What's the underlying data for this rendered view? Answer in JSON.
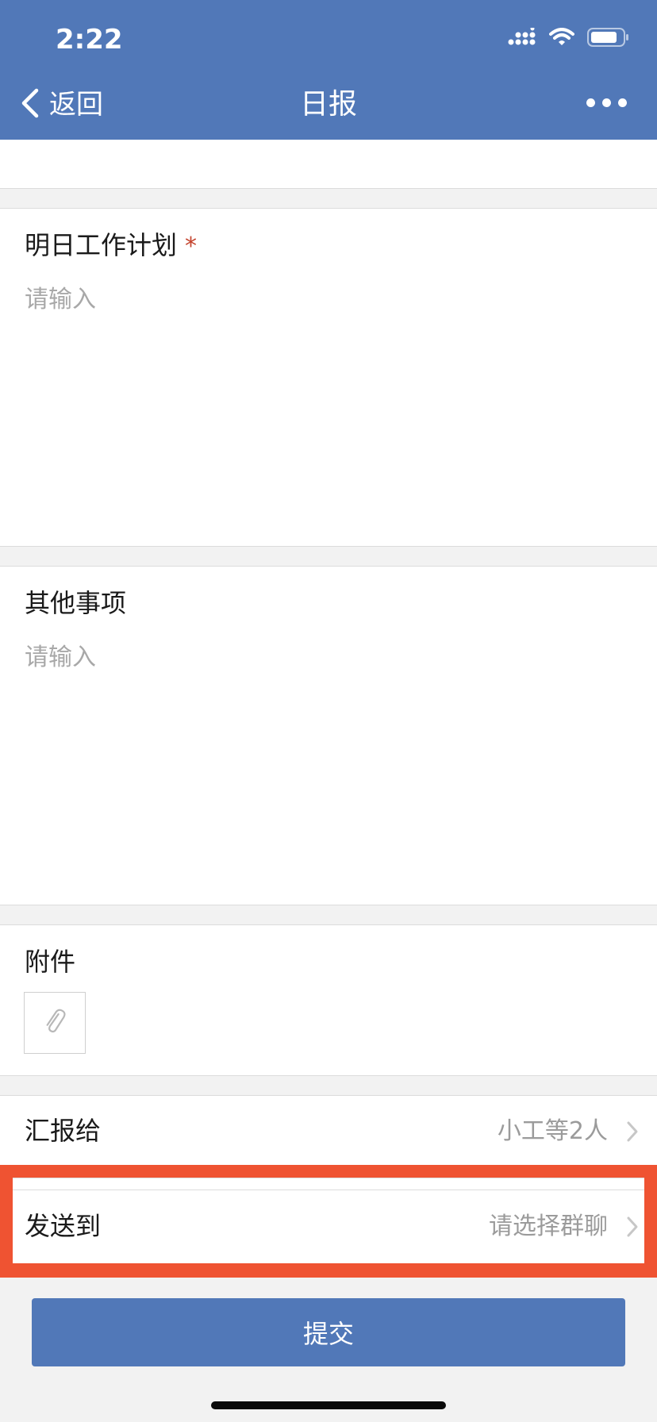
{
  "status": {
    "time": "2:22"
  },
  "nav": {
    "back_label": "返回",
    "title": "日报"
  },
  "sections": {
    "plan": {
      "label": "明日工作计划",
      "required_mark": "*",
      "placeholder": "请输入"
    },
    "other": {
      "label": "其他事项",
      "placeholder": "请输入"
    },
    "attachment": {
      "label": "附件"
    },
    "report_to": {
      "label": "汇报给",
      "value": "小工等2人"
    },
    "send_to": {
      "label": "发送到",
      "value": "请选择群聊"
    }
  },
  "submit_label": "提交",
  "colors": {
    "accent": "#5178b8",
    "highlight": "#ef5332",
    "required": "#c4442e"
  }
}
